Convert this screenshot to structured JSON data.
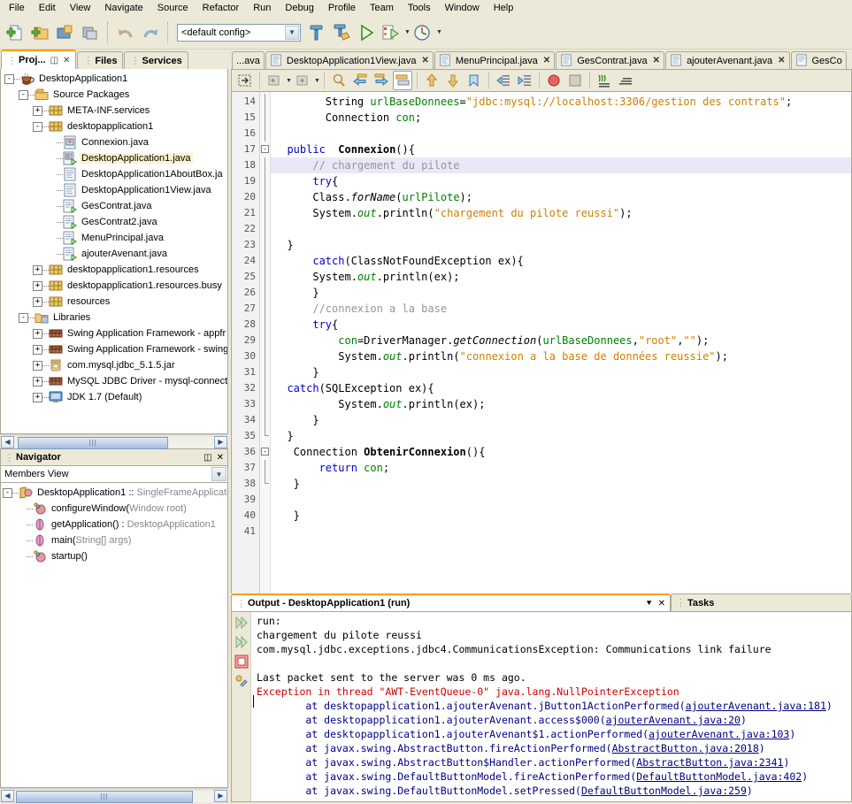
{
  "menubar": {
    "items": [
      {
        "label": "File"
      },
      {
        "label": "Edit"
      },
      {
        "label": "View"
      },
      {
        "label": "Navigate"
      },
      {
        "label": "Source"
      },
      {
        "label": "Refactor"
      },
      {
        "label": "Run"
      },
      {
        "label": "Debug"
      },
      {
        "label": "Profile"
      },
      {
        "label": "Team"
      },
      {
        "label": "Tools"
      },
      {
        "label": "Window"
      },
      {
        "label": "Help"
      }
    ]
  },
  "toolbar": {
    "config_value": "<default config>",
    "buttons": [
      {
        "name": "new-file-icon",
        "title": "New File"
      },
      {
        "name": "new-project-icon",
        "title": "New Project"
      },
      {
        "name": "open-project-icon",
        "title": "Open Project"
      },
      {
        "name": "save-all-icon",
        "title": "Save All"
      },
      {
        "name": "undo-icon",
        "title": "Undo"
      },
      {
        "name": "redo-icon",
        "title": "Redo"
      },
      {
        "name": "build-project-icon",
        "title": "Build Project"
      },
      {
        "name": "clean-build-icon",
        "title": "Clean and Build Project"
      },
      {
        "name": "run-project-icon",
        "title": "Run Project"
      },
      {
        "name": "debug-project-icon",
        "title": "Debug Project"
      },
      {
        "name": "profile-project-icon",
        "title": "Profile Project"
      }
    ]
  },
  "left_panel": {
    "tabs": [
      {
        "label": "Proj...",
        "active": true,
        "has_controls": true
      },
      {
        "label": "Files",
        "active": false
      },
      {
        "label": "Services",
        "active": false
      }
    ],
    "tree": [
      {
        "depth": 0,
        "toggle": "-",
        "icon": "coffee-cup-icon",
        "label": "DesktopApplication1",
        "selected": false
      },
      {
        "depth": 1,
        "toggle": "-",
        "icon": "source-packages-folder-icon",
        "label": "Source Packages",
        "selected": false
      },
      {
        "depth": 2,
        "toggle": "+",
        "icon": "package-icon",
        "label": "META-INF.services",
        "selected": false
      },
      {
        "depth": 2,
        "toggle": "-",
        "icon": "package-icon",
        "label": "desktopapplication1",
        "selected": false
      },
      {
        "depth": 3,
        "toggle": "",
        "icon": "java-class-icon",
        "label": "Connexion.java",
        "selected": false
      },
      {
        "depth": 3,
        "toggle": "",
        "icon": "java-main-class-icon",
        "label": "DesktopApplication1.java",
        "selected": true
      },
      {
        "depth": 3,
        "toggle": "",
        "icon": "java-file-icon",
        "label": "DesktopApplication1AboutBox.ja",
        "selected": false
      },
      {
        "depth": 3,
        "toggle": "",
        "icon": "java-file-icon",
        "label": "DesktopApplication1View.java",
        "selected": false
      },
      {
        "depth": 3,
        "toggle": "",
        "icon": "java-form-icon",
        "label": "GesContrat.java",
        "selected": false
      },
      {
        "depth": 3,
        "toggle": "",
        "icon": "java-form-icon",
        "label": "GesContrat2.java",
        "selected": false
      },
      {
        "depth": 3,
        "toggle": "",
        "icon": "java-form-icon",
        "label": "MenuPrincipal.java",
        "selected": false
      },
      {
        "depth": 3,
        "toggle": "",
        "icon": "java-form-icon",
        "label": "ajouterAvenant.java",
        "selected": false
      },
      {
        "depth": 2,
        "toggle": "+",
        "icon": "package-icon",
        "label": "desktopapplication1.resources",
        "selected": false
      },
      {
        "depth": 2,
        "toggle": "+",
        "icon": "package-icon",
        "label": "desktopapplication1.resources.busy",
        "selected": false
      },
      {
        "depth": 2,
        "toggle": "+",
        "icon": "package-icon",
        "label": "resources",
        "selected": false
      },
      {
        "depth": 1,
        "toggle": "-",
        "icon": "libraries-folder-icon",
        "label": "Libraries",
        "selected": false
      },
      {
        "depth": 2,
        "toggle": "+",
        "icon": "library-books-icon",
        "label": "Swing Application Framework - appfr",
        "selected": false
      },
      {
        "depth": 2,
        "toggle": "+",
        "icon": "library-books-icon",
        "label": "Swing Application Framework - swing",
        "selected": false
      },
      {
        "depth": 2,
        "toggle": "+",
        "icon": "jar-icon",
        "label": "com.mysql.jdbc_5.1.5.jar",
        "selected": false
      },
      {
        "depth": 2,
        "toggle": "+",
        "icon": "library-books-icon",
        "label": "MySQL JDBC Driver - mysql-connecto",
        "selected": false
      },
      {
        "depth": 2,
        "toggle": "+",
        "icon": "jdk-platform-icon",
        "label": "JDK 1.7 (Default)",
        "selected": false
      }
    ]
  },
  "navigator": {
    "title": "Navigator",
    "view_selector": "Members View",
    "items": [
      {
        "depth": 0,
        "toggle": "-",
        "icon": "class-icon",
        "label": "DesktopApplication1 :: ",
        "dim": "SingleFrameApplicatio"
      },
      {
        "depth": 1,
        "toggle": "",
        "icon": "protected-method-icon",
        "label": "configureWindow(",
        "dim": "Window root)"
      },
      {
        "depth": 1,
        "toggle": "",
        "icon": "static-method-icon",
        "label": "getApplication() : ",
        "dim": "DesktopApplication1"
      },
      {
        "depth": 1,
        "toggle": "",
        "icon": "static-method-icon",
        "label": "main(",
        "dim": "String[] args)"
      },
      {
        "depth": 1,
        "toggle": "",
        "icon": "protected-method-icon",
        "label": "startup()",
        "dim": ""
      }
    ]
  },
  "editor": {
    "tabs": [
      {
        "label": "...ava",
        "active": false,
        "closable": false,
        "truncated": true
      },
      {
        "label": "DesktopApplication1View.java",
        "active": false,
        "closable": true
      },
      {
        "label": "MenuPrincipal.java",
        "active": false,
        "closable": true
      },
      {
        "label": "GesContrat.java",
        "active": false,
        "closable": true
      },
      {
        "label": "ajouterAvenant.java",
        "active": false,
        "closable": true
      },
      {
        "label": "GesCo",
        "active": false,
        "closable": false,
        "truncated": true
      }
    ],
    "toolbar_buttons": [
      {
        "name": "toggle-rectangular-selection-icon"
      },
      {
        "name": "last-edit-back-icon"
      },
      {
        "name": "last-edit-forward-icon"
      },
      {
        "name": "find-selection-icon"
      },
      {
        "name": "find-previous-icon"
      },
      {
        "name": "find-next-icon"
      },
      {
        "name": "toggle-highlight-search-icon"
      },
      {
        "name": "previous-bookmark-icon"
      },
      {
        "name": "next-bookmark-icon"
      },
      {
        "name": "toggle-bookmark-icon"
      },
      {
        "name": "shift-line-left-icon"
      },
      {
        "name": "shift-line-right-icon"
      },
      {
        "name": "toggle-breakpoint-icon"
      },
      {
        "name": "stop-icon"
      },
      {
        "name": "start-macro-recording-icon"
      },
      {
        "name": "stop-macro-recording-icon"
      }
    ],
    "first_visible_line": 14,
    "highlighted_line": 18,
    "lines": [
      {
        "n": 14,
        "fold": "bar",
        "tokens": [
          {
            "t": "        ",
            "c": ""
          },
          {
            "t": "String",
            "c": ""
          },
          {
            "t": " ",
            "c": ""
          },
          {
            "t": "urlBaseDonnees",
            "c": "fld"
          },
          {
            "t": "=",
            "c": ""
          },
          {
            "t": "\"jdbc:mysql://localhost:3306/gestion des contrats\"",
            "c": "str"
          },
          {
            "t": ";",
            "c": ""
          }
        ]
      },
      {
        "n": 15,
        "fold": "bar",
        "tokens": [
          {
            "t": "        Connection ",
            "c": ""
          },
          {
            "t": "con",
            "c": "fld"
          },
          {
            "t": ";",
            "c": ""
          }
        ]
      },
      {
        "n": 16,
        "fold": "bar",
        "tokens": []
      },
      {
        "n": 17,
        "fold": "box",
        "tokens": [
          {
            "t": "  ",
            "c": ""
          },
          {
            "t": "public",
            "c": "k"
          },
          {
            "t": "  ",
            "c": ""
          },
          {
            "t": "Connexion",
            "c": "bold"
          },
          {
            "t": "(){",
            "c": ""
          }
        ]
      },
      {
        "n": 18,
        "fold": "bar",
        "highlight": true,
        "tokens": [
          {
            "t": "      ",
            "c": ""
          },
          {
            "t": "// chargement du pilote",
            "c": "cm"
          }
        ]
      },
      {
        "n": 19,
        "fold": "bar",
        "tokens": [
          {
            "t": "      ",
            "c": ""
          },
          {
            "t": "try",
            "c": "k"
          },
          {
            "t": "{",
            "c": ""
          }
        ]
      },
      {
        "n": 20,
        "fold": "bar",
        "tokens": [
          {
            "t": "      Class.",
            "c": ""
          },
          {
            "t": "forName",
            "c": "mth"
          },
          {
            "t": "(",
            "c": ""
          },
          {
            "t": "urlPilote",
            "c": "fld"
          },
          {
            "t": ");",
            "c": ""
          }
        ]
      },
      {
        "n": 21,
        "fold": "bar",
        "tokens": [
          {
            "t": "      System.",
            "c": ""
          },
          {
            "t": "out",
            "c": "mth grn"
          },
          {
            "t": ".println(",
            "c": ""
          },
          {
            "t": "\"chargement du pilote reussi\"",
            "c": "str"
          },
          {
            "t": ");",
            "c": ""
          }
        ]
      },
      {
        "n": 22,
        "fold": "bar",
        "tokens": []
      },
      {
        "n": 23,
        "fold": "bar",
        "tokens": [
          {
            "t": "  }",
            "c": ""
          }
        ]
      },
      {
        "n": 24,
        "fold": "bar",
        "tokens": [
          {
            "t": "      ",
            "c": ""
          },
          {
            "t": "catch",
            "c": "k"
          },
          {
            "t": "(ClassNotFoundException ex){",
            "c": ""
          }
        ]
      },
      {
        "n": 25,
        "fold": "bar",
        "tokens": [
          {
            "t": "      System.",
            "c": ""
          },
          {
            "t": "out",
            "c": "mth grn"
          },
          {
            "t": ".println(ex);",
            "c": ""
          }
        ]
      },
      {
        "n": 26,
        "fold": "bar",
        "tokens": [
          {
            "t": "      }",
            "c": ""
          }
        ]
      },
      {
        "n": 27,
        "fold": "bar",
        "tokens": [
          {
            "t": "      ",
            "c": ""
          },
          {
            "t": "//connexion a la base",
            "c": "cm"
          }
        ]
      },
      {
        "n": 28,
        "fold": "bar",
        "tokens": [
          {
            "t": "      ",
            "c": ""
          },
          {
            "t": "try",
            "c": "k"
          },
          {
            "t": "{",
            "c": ""
          }
        ]
      },
      {
        "n": 29,
        "fold": "bar",
        "tokens": [
          {
            "t": "          ",
            "c": ""
          },
          {
            "t": "con",
            "c": "fld"
          },
          {
            "t": "=DriverManager.",
            "c": ""
          },
          {
            "t": "getConnection",
            "c": "mth"
          },
          {
            "t": "(",
            "c": ""
          },
          {
            "t": "urlBaseDonnees",
            "c": "fld"
          },
          {
            "t": ",",
            "c": ""
          },
          {
            "t": "\"root\"",
            "c": "str"
          },
          {
            "t": ",",
            "c": ""
          },
          {
            "t": "\"\"",
            "c": "str"
          },
          {
            "t": ");",
            "c": ""
          }
        ]
      },
      {
        "n": 30,
        "fold": "bar",
        "tokens": [
          {
            "t": "          System.",
            "c": ""
          },
          {
            "t": "out",
            "c": "mth grn"
          },
          {
            "t": ".println(",
            "c": ""
          },
          {
            "t": "\"connexion a la base de données reussie\"",
            "c": "str"
          },
          {
            "t": ");",
            "c": ""
          }
        ]
      },
      {
        "n": 31,
        "fold": "bar",
        "tokens": [
          {
            "t": "      }",
            "c": ""
          }
        ]
      },
      {
        "n": 32,
        "fold": "bar",
        "tokens": [
          {
            "t": "  ",
            "c": ""
          },
          {
            "t": "catch",
            "c": "k"
          },
          {
            "t": "(SQLException ex){",
            "c": ""
          }
        ]
      },
      {
        "n": 33,
        "fold": "bar",
        "tokens": [
          {
            "t": "          System.",
            "c": ""
          },
          {
            "t": "out",
            "c": "mth grn"
          },
          {
            "t": ".println(ex);",
            "c": ""
          }
        ]
      },
      {
        "n": 34,
        "fold": "bar",
        "tokens": [
          {
            "t": "      }",
            "c": ""
          }
        ]
      },
      {
        "n": 35,
        "fold": "end",
        "tokens": [
          {
            "t": "  }",
            "c": ""
          }
        ]
      },
      {
        "n": 36,
        "fold": "box",
        "tokens": [
          {
            "t": "   Connection ",
            "c": ""
          },
          {
            "t": "ObtenirConnexion",
            "c": "bold"
          },
          {
            "t": "(){",
            "c": ""
          }
        ]
      },
      {
        "n": 37,
        "fold": "bar",
        "tokens": [
          {
            "t": "       ",
            "c": ""
          },
          {
            "t": "return",
            "c": "k"
          },
          {
            "t": " ",
            "c": ""
          },
          {
            "t": "con",
            "c": "fld"
          },
          {
            "t": ";",
            "c": ""
          }
        ]
      },
      {
        "n": 38,
        "fold": "end",
        "tokens": [
          {
            "t": "   }",
            "c": ""
          }
        ]
      },
      {
        "n": 39,
        "fold": "",
        "tokens": []
      },
      {
        "n": 40,
        "fold": "",
        "tokens": [
          {
            "t": "   }",
            "c": ""
          }
        ]
      },
      {
        "n": 41,
        "fold": "",
        "tokens": []
      }
    ]
  },
  "output": {
    "tabs": [
      {
        "label": "Output - DesktopApplication1 (run)",
        "active": true
      },
      {
        "label": "Tasks",
        "active": false
      }
    ],
    "side_icons": [
      {
        "name": "rerun-icon"
      },
      {
        "name": "rerun-with-different-params-icon"
      },
      {
        "name": "stop-process-icon"
      },
      {
        "name": "ant-settings-icon"
      }
    ],
    "lines": [
      {
        "text": "run:",
        "style": "plain"
      },
      {
        "text": "chargement du pilote reussi",
        "style": "plain"
      },
      {
        "text": "com.mysql.jdbc.exceptions.jdbc4.CommunicationsException: Communications link failure",
        "style": "plain"
      },
      {
        "text": "",
        "style": "plain"
      },
      {
        "text": "Last packet sent to the server was 0 ms ago.",
        "style": "plain"
      },
      {
        "text": "Exception in thread \"AWT-EventQueue-0\" java.lang.NullPointerException",
        "style": "err"
      },
      {
        "prefix": "        at desktopapplication1.ajouterAvenant.jButton1ActionPerformed(",
        "link": "ajouterAvenant.java:181",
        "suffix": ")",
        "style": "trace"
      },
      {
        "prefix": "        at desktopapplication1.ajouterAvenant.access$000(",
        "link": "ajouterAvenant.java:20",
        "suffix": ")",
        "style": "trace"
      },
      {
        "prefix": "        at desktopapplication1.ajouterAvenant$1.actionPerformed(",
        "link": "ajouterAvenant.java:103",
        "suffix": ")",
        "style": "trace"
      },
      {
        "prefix": "        at javax.swing.AbstractButton.fireActionPerformed(",
        "link": "AbstractButton.java:2018",
        "suffix": ")",
        "style": "trace"
      },
      {
        "prefix": "        at javax.swing.AbstractButton$Handler.actionPerformed(",
        "link": "AbstractButton.java:2341",
        "suffix": ")",
        "style": "trace"
      },
      {
        "prefix": "        at javax.swing.DefaultButtonModel.fireActionPerformed(",
        "link": "DefaultButtonModel.java:402",
        "suffix": ")",
        "style": "trace"
      },
      {
        "prefix": "        at javax.swing.DefaultButtonModel.setPressed(",
        "link": "DefaultButtonModel.java:259",
        "suffix": ")",
        "style": "trace"
      }
    ]
  },
  "colors": {
    "window_bg": "#ece9d8",
    "active_tab_accent": "#ff9c00",
    "selection_bg": "#fdf3cd",
    "string_literal": "#cc8000",
    "keyword": "#0000cc",
    "comment": "#969696",
    "field": "#008000",
    "error_text": "#cc0000",
    "stacktrace_text": "#000080"
  }
}
